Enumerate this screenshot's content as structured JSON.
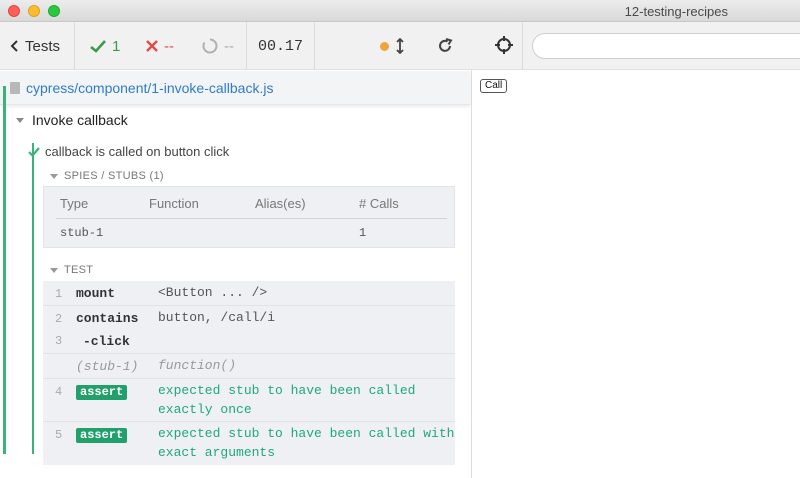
{
  "window": {
    "title": "12-testing-recipes"
  },
  "stats": {
    "tests_label": "Tests",
    "passed": "1",
    "failed": "--",
    "pending": "--",
    "duration": "00.17"
  },
  "file": {
    "path": "cypress/component/1-invoke-callback.js"
  },
  "suite": {
    "title": "Invoke callback"
  },
  "test": {
    "title": "callback is called on button click"
  },
  "spies": {
    "header": "SPIES / STUBS (1)",
    "columns": [
      "Type",
      "Function",
      "Alias(es)",
      "# Calls"
    ],
    "rows": [
      {
        "type": "stub-1",
        "function": "",
        "alias": "",
        "calls": "1"
      }
    ]
  },
  "commands": {
    "header": "TEST",
    "items": [
      {
        "num": "1",
        "name": "mount",
        "message": "<Button ... />"
      },
      {
        "num": "2",
        "name": "contains",
        "message": "button, /call/i"
      },
      {
        "num": "3",
        "name": "-click",
        "message": ""
      },
      {
        "num": "",
        "name": "(stub-1)",
        "message": "function()"
      },
      {
        "num": "4",
        "name": "assert",
        "message_line1": "expected stub to have been called",
        "message_line2": "exactly once"
      },
      {
        "num": "5",
        "name": "assert",
        "message_line1": "expected stub to have been called with",
        "message_line2": "exact arguments"
      }
    ]
  },
  "preview": {
    "url_value": "",
    "call_button": "Call"
  },
  "colors": {
    "pass": "#3a9a4a",
    "fail": "#e14b4b",
    "link": "#2e7bcf",
    "rail": "#3ab57a",
    "assert_badge": "#22a06b",
    "assert_text": "#1fa97a"
  },
  "icons": {
    "back": "chevron-left-icon",
    "pass": "check-icon",
    "fail": "x-icon",
    "pending": "circle-notch-icon",
    "status": "dot-icon",
    "autoscroll": "arrows-up-down-icon",
    "reload": "reload-icon",
    "file": "file-icon",
    "selector": "crosshair-icon"
  }
}
